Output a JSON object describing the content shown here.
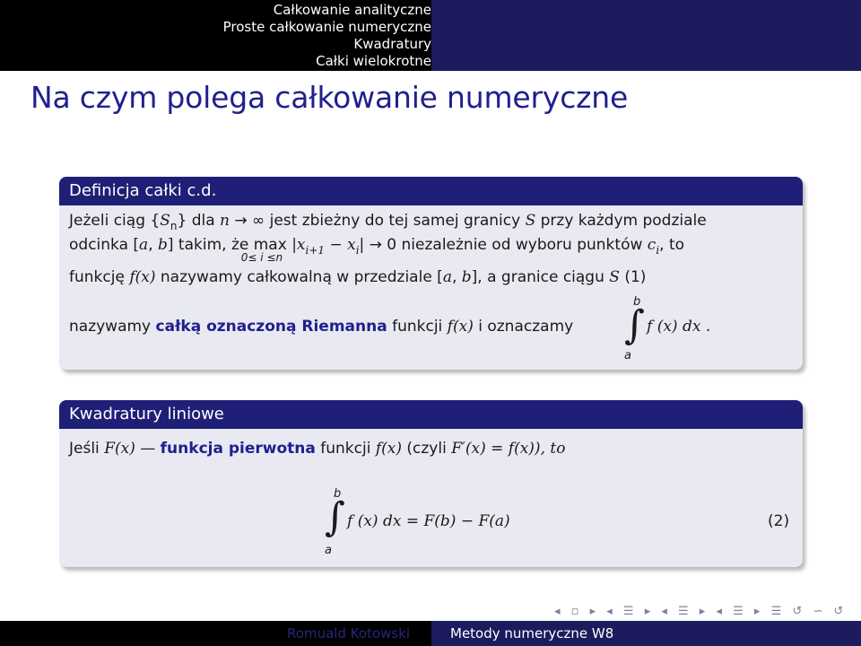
{
  "header": {
    "nav_items": [
      "Całkowanie analityczne",
      "Proste całkowanie numeryczne",
      "Kwadratury",
      "Całki wielokrotne"
    ]
  },
  "frame": {
    "title": "Na czym polega całkowanie numeryczne"
  },
  "block1": {
    "title": "Definicja całki c.d.",
    "l1_a": "Jeżeli ciąg {",
    "l1_s": "S",
    "l1_n": "n",
    "l1_b": "} dla ",
    "l1_nvar": "n",
    "l1_arrow": " → ∞ ",
    "l1_c": "jest zbieżny do tej samej granicy ",
    "l1_S": "S",
    "l1_d": " przy każdym podziale",
    "l2_a": "odcinka [",
    "l2_avar": "a",
    "l2_comma": ", ",
    "l2_bvar": "b",
    "l2_b": "] takim, że ",
    "l2_max": "max",
    "l2_maxsub": "0≤ i ≤n",
    "l2_abs": "|x",
    "l2_i1": "i+1",
    "l2_minus": " − x",
    "l2_i": "i",
    "l2_abs2": "| → 0 niezależnie od wyboru punktów ",
    "l2_c": "c",
    "l2_ci": "i",
    "l2_to": ", to",
    "l3_a": "funkcję ",
    "l3_f": "f",
    "l3_x": "(x)",
    "l3_b": " nazywamy całkowalną w przedziale [",
    "l3_av": "a",
    "l3_comma": ", ",
    "l3_bv": "b",
    "l3_c": "], a granice ciągu ",
    "l3_S": "S",
    "l3_d": " (1)",
    "l4_a": "nazywamy ",
    "l4_bold": "całką oznaczoną Riemanna",
    "l4_b": " funkcji ",
    "l4_f": "f",
    "l4_x": "(x)",
    "l4_c": " i oznaczamy",
    "l4_int_upper": "b",
    "l4_int_lower": "a",
    "l4_int_sign": "∫",
    "l4_integrand": "f (x) dx .",
    "l4_period": ""
  },
  "block2": {
    "title": "Kwadratury liniowe",
    "l1_a": "Jeśli ",
    "l1_F": "F",
    "l1_x": "(x)",
    "l1_dash": " — ",
    "l1_bold": "funkcja pierwotna",
    "l1_b": " funkcji ",
    "l1_f": "f",
    "l1_x2": "(x)",
    "l1_c": " (czyli ",
    "l1_Fp": "F′",
    "l1_x3": "(x) = ",
    "l1_f2": "f",
    "l1_x4": "(x)), to",
    "eq_upper": "b",
    "eq_lower": "a",
    "eq_sign": "∫",
    "eq_body": "f (x) dx = F(b) − F(a)",
    "eq_number": "(2)"
  },
  "footer": {
    "nav_symbols": "◂ ▫ ▸ ◂ ☰ ▸ ◂ ☰ ▸ ◂ ☰ ▸ ☰ ↺ ∽ ↺",
    "author": "Romuald Kotowski",
    "title": "Metody numeryczne W8"
  },
  "colors": {
    "header_left": "#000000",
    "header_right": "#1b1b5e",
    "title_text": "#1f1f8f",
    "block_title_bg": "#1f1f77",
    "block_body_bg": "#e9e9f1"
  }
}
